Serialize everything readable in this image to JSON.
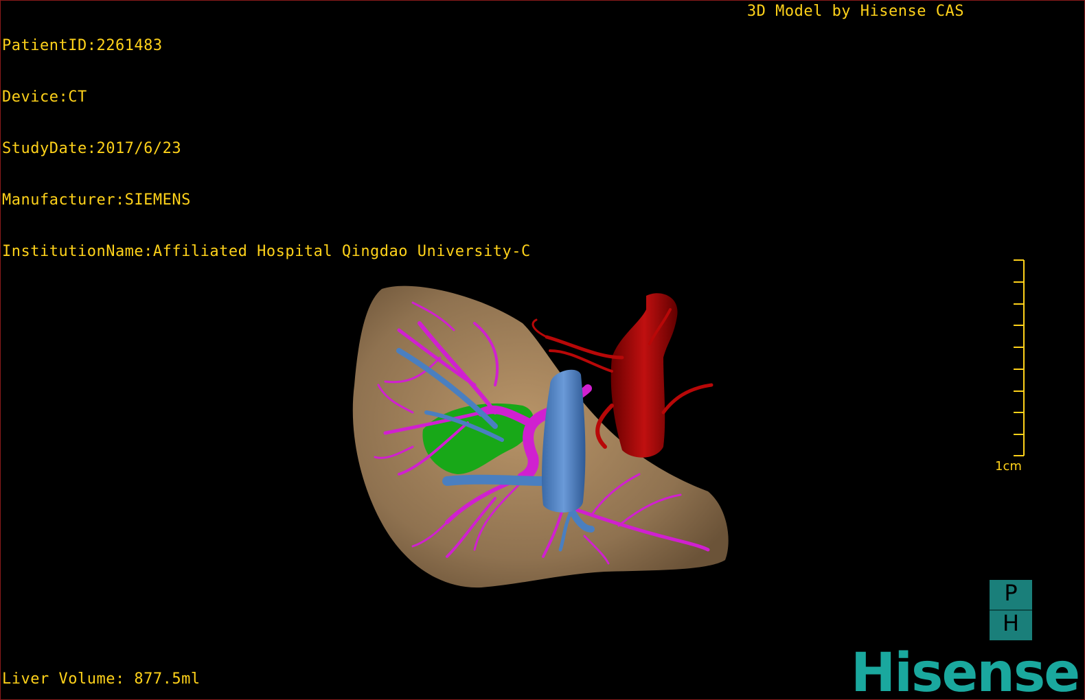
{
  "overlay": {
    "patient_id": "PatientID:2261483",
    "device": "Device:CT",
    "study_date": "StudyDate:2017/6/23",
    "manufacturer": "Manufacturer:SIEMENS",
    "institution": "InstitutionName:Affiliated Hospital Qingdao University-C",
    "credit": "3D Model by Hisense CAS",
    "liver_volume": "Liver Volume: 877.5ml"
  },
  "scale_bar": {
    "label": "1cm",
    "color": "#ffd21a"
  },
  "orientation_cube": {
    "top": "P",
    "bottom": "H",
    "color": "#1a7f7a"
  },
  "logo": {
    "text": "Hisense",
    "color": "#1aa89e"
  },
  "model_colors": {
    "liver": "#a0825a",
    "portal_vein": "#d020d0",
    "hepatic_vein": "#4a7fc0",
    "gallbladder": "#18a818",
    "artery": "#b80808"
  }
}
